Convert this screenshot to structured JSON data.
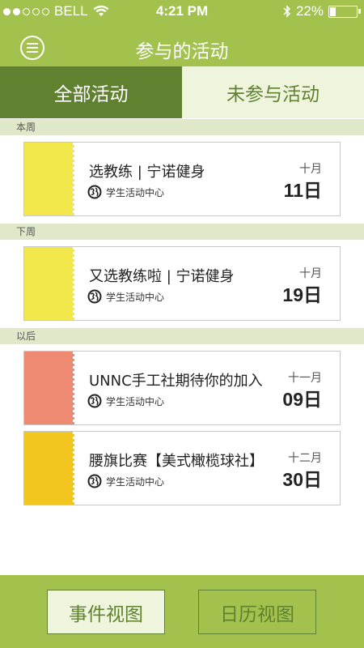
{
  "status_bar": {
    "carrier": "BELL",
    "time": "4:21 PM",
    "battery": "22%",
    "battery_level": 0.22
  },
  "nav": {
    "title": "参与的活动",
    "menu_icon": "menu-icon"
  },
  "tabs": [
    {
      "label": "全部活动",
      "active": true
    },
    {
      "label": "未参与活动",
      "active": false
    }
  ],
  "sections": [
    {
      "label": "本周"
    },
    {
      "label": "下周"
    },
    {
      "label": "以后"
    }
  ],
  "events": [
    {
      "title": "选教练 | 宁诺健身",
      "location": "学生活动中心",
      "month": "十月",
      "day": "11日",
      "color": "#f2e84c"
    },
    {
      "title": "又选教练啦 | 宁诺健身",
      "location": "学生活动中心",
      "month": "十月",
      "day": "19日",
      "color": "#f2e84c"
    },
    {
      "title": "UNNC手工社期待你的加入",
      "location": "学生活动中心",
      "month": "十一月",
      "day": "09日",
      "color": "#ef8a72"
    },
    {
      "title": "腰旗比赛【美式橄榄球社】",
      "location": "学生活动中心",
      "month": "十二月",
      "day": "30日",
      "color": "#f2c51f"
    }
  ],
  "bottom": {
    "event_view": "事件视图",
    "calendar_view": "日历视图"
  },
  "colors": {
    "primary": "#a3c24d",
    "dark_green": "#5f8130",
    "light_green": "#eef5dc",
    "section_bg": "#dfe9c9"
  }
}
